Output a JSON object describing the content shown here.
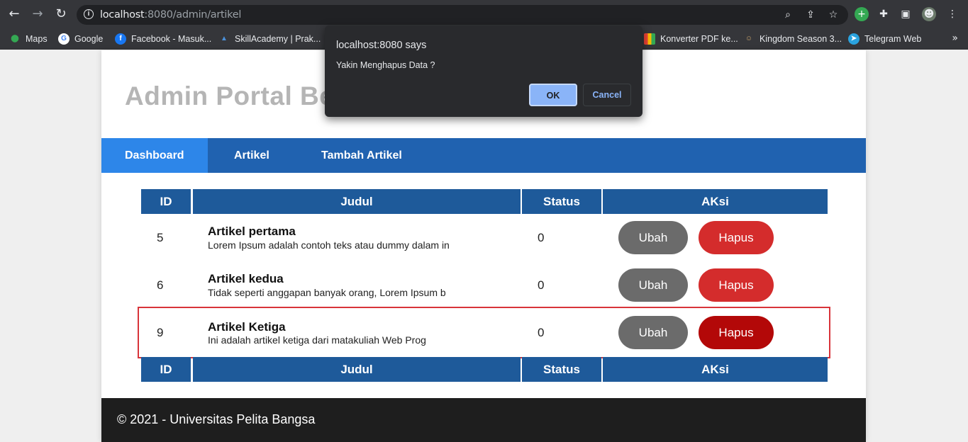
{
  "browser": {
    "url_host": "localhost",
    "url_rest": ":8080/admin/artikel",
    "bookmarks": [
      {
        "label": "Maps",
        "color": "#34a853",
        "glyph": "⬤"
      },
      {
        "label": "Google",
        "color": "#4285f4",
        "glyph": "G"
      },
      {
        "label": "Facebook - Masuk...",
        "color": "#1877f2",
        "glyph": "f"
      },
      {
        "label": "SkillAcademy | Prak...",
        "color": "#4a90d9",
        "glyph": "▲"
      },
      {
        "label": "Konverter PDF ke...",
        "color": "#e94235",
        "glyph": "■"
      },
      {
        "label": "Kingdom Season 3...",
        "color": "#8a6d3b",
        "glyph": "☺"
      },
      {
        "label": "Telegram Web",
        "color": "#2aa3df",
        "glyph": "➤"
      }
    ],
    "more": "»"
  },
  "site": {
    "title": "Admin Portal Be",
    "menu": [
      "Dashboard",
      "Artikel",
      "Tambah Artikel"
    ]
  },
  "table": {
    "headers": [
      "ID",
      "Judul",
      "Status",
      "AKsi"
    ],
    "rows": [
      {
        "id": "5",
        "title": "Artikel pertama",
        "desc": "Lorem Ipsum adalah contoh teks atau dummy dalam in",
        "status": "0"
      },
      {
        "id": "6",
        "title": "Artikel kedua",
        "desc": "Tidak seperti anggapan banyak orang, Lorem Ipsum b",
        "status": "0"
      },
      {
        "id": "9",
        "title": "Artikel Ketiga",
        "desc": "Ini adalah artikel ketiga dari matakuliah Web Prog",
        "status": "0"
      }
    ],
    "edit_label": "Ubah",
    "delete_label": "Hapus"
  },
  "footer": {
    "text": "© 2021 - Universitas Pelita Bangsa"
  },
  "dialog": {
    "title": "localhost:8080 says",
    "message": "Yakin Menghapus Data ?",
    "ok": "OK",
    "cancel": "Cancel"
  }
}
